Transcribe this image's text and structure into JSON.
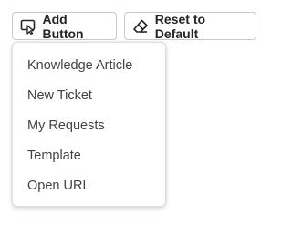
{
  "toolbar": {
    "add_button": {
      "label": "Add Button",
      "icon": "add-button-icon"
    },
    "reset_button": {
      "label": "Reset to Default",
      "icon": "eraser-icon"
    }
  },
  "menu": {
    "items": [
      {
        "label": "Knowledge Article"
      },
      {
        "label": "New Ticket"
      },
      {
        "label": "My Requests"
      },
      {
        "label": "Template"
      },
      {
        "label": "Open URL"
      }
    ]
  },
  "colors": {
    "text": "#242424",
    "menu_text": "#424242",
    "border": "#c9c9c9"
  }
}
